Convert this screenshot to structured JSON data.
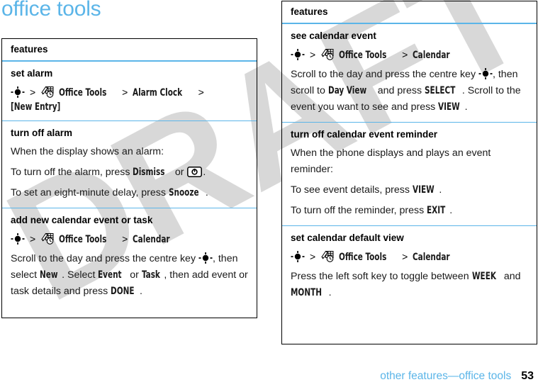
{
  "page": {
    "title": "office tools",
    "accent_color": "#5bb5e8",
    "watermark": "DRAFT"
  },
  "footer": {
    "label": "other features—office tools",
    "page_number": "53"
  },
  "left_table": {
    "header": "features",
    "rows": [
      {
        "title": "set alarm",
        "path": {
          "center_key_icon": "center-key-icon",
          "sep1": ">",
          "office_tools_icon": "office-tools-icon",
          "menu1": "Office Tools",
          "sep2": ">",
          "menu2": "Alarm Clock",
          "sep3": ">",
          "menu3": "[New Entry]"
        },
        "lines": []
      },
      {
        "title": "turn off alarm",
        "lines": [
          {
            "pre": "When the display shows an alarm:"
          },
          {
            "pre": "To turn off the alarm, press ",
            "ui1": "Dismiss",
            "mid": " or ",
            "icon": "power-key-icon",
            "post": "."
          },
          {
            "pre": "To set an eight-minute delay, press ",
            "ui1": "Snooze",
            "post": "."
          }
        ]
      },
      {
        "title": "add new calendar event or task",
        "path": {
          "center_key_icon": "center-key-icon",
          "sep1": ">",
          "office_tools_icon": "office-tools-icon",
          "menu1": "Office Tools",
          "sep2": ">",
          "menu2": "Calendar"
        },
        "lines": [
          {
            "pre": "Scroll to the day and press the centre key ",
            "inline_icon": "center-key-icon",
            "mid1": ", then select ",
            "ui1": "New",
            "mid2": ". Select ",
            "ui2": "Event",
            "mid3": " or ",
            "ui3": "Task",
            "mid4": ", then add event or task details and press ",
            "ui4": "DONE",
            "post": "."
          }
        ]
      }
    ]
  },
  "right_table": {
    "header": "features",
    "rows": [
      {
        "title": "see calendar event",
        "path": {
          "center_key_icon": "center-key-icon",
          "sep1": ">",
          "office_tools_icon": "office-tools-icon",
          "menu1": "Office Tools",
          "sep2": ">",
          "menu2": "Calendar"
        },
        "lines": [
          {
            "pre": "Scroll to the day and press the centre key ",
            "inline_icon": "center-key-icon",
            "mid1": ", then scroll to ",
            "ui1": "Day View",
            "mid2": " and press ",
            "ui2": "SELECT",
            "mid3": ". Scroll to the event you want to see and press ",
            "ui3": "VIEW",
            "post": "."
          }
        ]
      },
      {
        "title": "turn off calendar event reminder",
        "lines": [
          {
            "pre": "When the phone displays and plays an event reminder:"
          },
          {
            "pre": "To see event details, press ",
            "ui1": "VIEW",
            "post": "."
          },
          {
            "pre": "To turn off the reminder, press ",
            "ui1": "EXIT",
            "post": "."
          }
        ]
      },
      {
        "title": "set calendar default view",
        "path": {
          "center_key_icon": "center-key-icon",
          "sep1": ">",
          "office_tools_icon": "office-tools-icon",
          "menu1": "Office Tools",
          "sep2": ">",
          "menu2": "Calendar"
        },
        "lines": [
          {
            "pre": "Press the left soft key to toggle between ",
            "ui1": "WEEK",
            "mid1": " and ",
            "ui2": "MONTH",
            "post": "."
          }
        ]
      }
    ]
  }
}
